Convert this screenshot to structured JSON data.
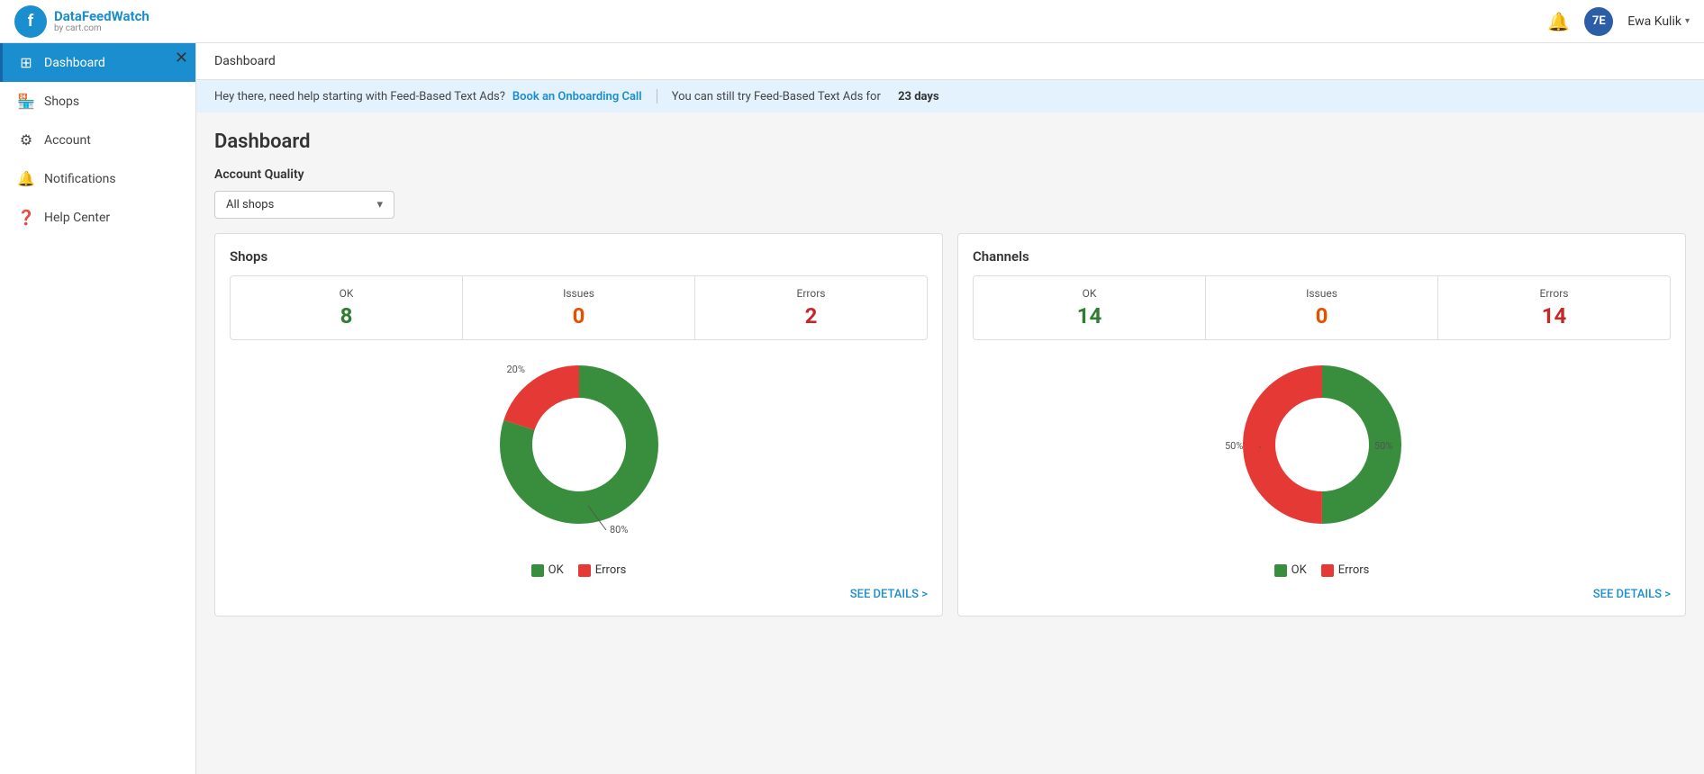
{
  "header": {
    "logo_name": "DataFeedWatch",
    "logo_sub": "by cart.com",
    "logo_letter": "f",
    "notification_icon": "🔔",
    "user_initials": "7E",
    "user_name": "Ewa Kulik"
  },
  "sidebar": {
    "close_icon": "✕",
    "items": [
      {
        "id": "dashboard",
        "label": "Dashboard",
        "icon": "⊞",
        "active": true
      },
      {
        "id": "shops",
        "label": "Shops",
        "icon": "🏪",
        "active": false
      },
      {
        "id": "account",
        "label": "Account",
        "icon": "⚙",
        "active": false
      },
      {
        "id": "notifications",
        "label": "Notifications",
        "icon": "🔔",
        "active": false
      },
      {
        "id": "help-center",
        "label": "Help Center",
        "icon": "❓",
        "active": false
      }
    ]
  },
  "breadcrumb": "Dashboard",
  "banner": {
    "text_before": "Hey there, need help starting with Feed-Based Text Ads?",
    "link_text": "Book an Onboarding Call",
    "text_after": "You can still try Feed-Based Text Ads for",
    "days": "23 days"
  },
  "main": {
    "title": "Dashboard",
    "section_label": "Account Quality",
    "dropdown": {
      "value": "All shops",
      "options": [
        "All shops"
      ]
    }
  },
  "shops_panel": {
    "title": "Shops",
    "stats": [
      {
        "label": "OK",
        "value": "8",
        "color": "green"
      },
      {
        "label": "Issues",
        "value": "0",
        "color": "orange"
      },
      {
        "label": "Errors",
        "value": "2",
        "color": "red"
      }
    ],
    "chart": {
      "ok_percent": 80,
      "error_percent": 20,
      "ok_label": "80%",
      "error_label": "20%"
    },
    "legend": {
      "ok": "OK",
      "errors": "Errors"
    },
    "see_details": "SEE DETAILS >"
  },
  "channels_panel": {
    "title": "Channels",
    "stats": [
      {
        "label": "OK",
        "value": "14",
        "color": "green"
      },
      {
        "label": "Issues",
        "value": "0",
        "color": "orange"
      },
      {
        "label": "Errors",
        "value": "14",
        "color": "red"
      }
    ],
    "chart": {
      "ok_percent": 50,
      "error_percent": 50,
      "ok_label": "50%",
      "error_label": "50%"
    },
    "legend": {
      "ok": "OK",
      "errors": "Errors"
    },
    "see_details": "SEE DETAILS >"
  },
  "colors": {
    "green": "#388e3c",
    "red": "#e53935",
    "blue": "#1b8ecf"
  }
}
